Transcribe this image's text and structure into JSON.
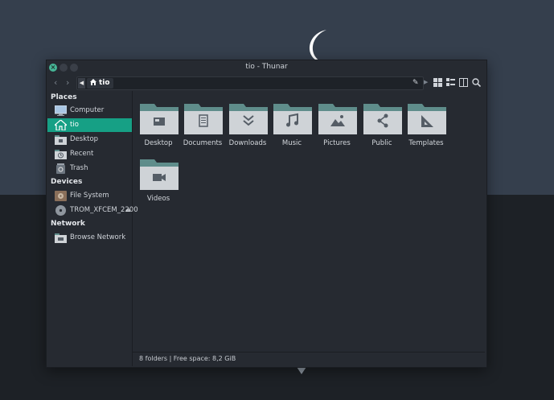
{
  "window": {
    "title": "tio - Thunar"
  },
  "pathbar": {
    "current": "tio"
  },
  "sidebar": {
    "places_header": "Places",
    "places": [
      {
        "label": "Computer",
        "icon": "computer-icon"
      },
      {
        "label": "tio",
        "icon": "home-icon",
        "active": true
      },
      {
        "label": "Desktop",
        "icon": "desktop-folder-icon"
      },
      {
        "label": "Recent",
        "icon": "recent-folder-icon"
      },
      {
        "label": "Trash",
        "icon": "trash-icon"
      }
    ],
    "devices_header": "Devices",
    "devices": [
      {
        "label": "File System",
        "icon": "harddisk-icon"
      },
      {
        "label": "TROM_XFCEM_2200",
        "icon": "optical-disc-icon"
      }
    ],
    "network_header": "Network",
    "network": [
      {
        "label": "Browse Network",
        "icon": "network-folder-icon"
      }
    ]
  },
  "folders": [
    {
      "label": "Desktop",
      "icon": "desktop-folder-icon"
    },
    {
      "label": "Documents",
      "icon": "documents-folder-icon"
    },
    {
      "label": "Downloads",
      "icon": "downloads-folder-icon"
    },
    {
      "label": "Music",
      "icon": "music-folder-icon"
    },
    {
      "label": "Pictures",
      "icon": "pictures-folder-icon"
    },
    {
      "label": "Public",
      "icon": "public-folder-icon"
    },
    {
      "label": "Templates",
      "icon": "templates-folder-icon"
    },
    {
      "label": "Videos",
      "icon": "videos-folder-icon"
    }
  ],
  "status": {
    "text": "8 folders  |  Free space: 8,2 GiB"
  },
  "colors": {
    "accent": "#16a085",
    "folder_body": "#cfd3d7",
    "folder_tab": "#5f8d8b",
    "window_bg": "#262a31"
  }
}
